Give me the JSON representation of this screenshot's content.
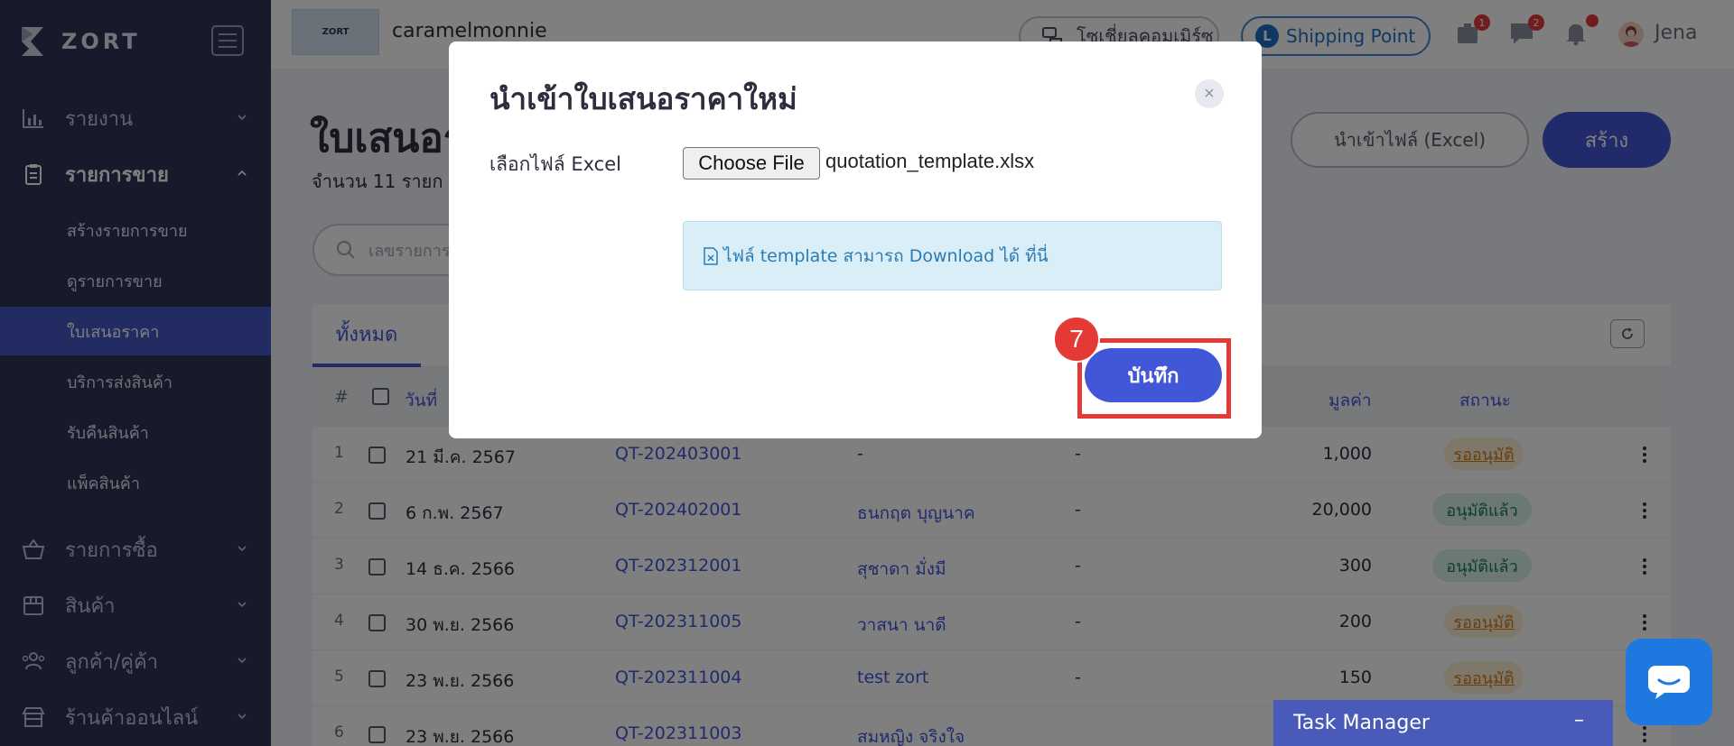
{
  "brand": {
    "name": "ZORT"
  },
  "sidebar": {
    "sections": [
      {
        "label": "รายงาน"
      },
      {
        "label": "รายการขาย"
      },
      {
        "label": "รายการซื้อ"
      },
      {
        "label": "สินค้า"
      },
      {
        "label": "ลูกค้า/คู่ค้า"
      },
      {
        "label": "ร้านค้าออนไลน์"
      }
    ],
    "sales_items": [
      {
        "label": "สร้างรายการขาย"
      },
      {
        "label": "ดูรายการขาย"
      },
      {
        "label": "ใบเสนอราคา"
      },
      {
        "label": "บริการส่งสินค้า"
      },
      {
        "label": "รับคืนสินค้า"
      },
      {
        "label": "แพ็คสินค้า"
      }
    ]
  },
  "header": {
    "shop_logo_text": "ZORT",
    "shop_name": "caramelmonnie",
    "social_label": "โซเชี่ยลคอมเมิร์ซ",
    "shipping_letter": "L",
    "shipping_label": "Shipping Point",
    "badges": {
      "box": "1",
      "chat": "2",
      "bell": ""
    },
    "user_name": "Jena"
  },
  "page": {
    "title": "ใบเสนอร",
    "subtitle": "จำนวน 11 รายก",
    "import_button": "นำเข้าไฟล์ (Excel)",
    "create_button": "สร้าง",
    "search_placeholder": "เลขรายการ"
  },
  "table": {
    "active_tab": "ทั้งหมด",
    "headers": {
      "num": "#",
      "date": "วันที่",
      "value": "มูลค่า",
      "status": "สถานะ"
    },
    "rows": [
      {
        "num": "1",
        "date": "21 มี.ค. 2567",
        "doc": "QT-202403001",
        "customer": "-",
        "ref": "-",
        "value": "1,000",
        "status": "รออนุมัติ",
        "status_type": "pending"
      },
      {
        "num": "2",
        "date": "6 ก.พ. 2567",
        "doc": "QT-202402001",
        "customer": "ธนกฤต บุญนาค",
        "ref": "-",
        "value": "20,000",
        "status": "อนุมัติแล้ว",
        "status_type": "approved"
      },
      {
        "num": "3",
        "date": "14 ธ.ค. 2566",
        "doc": "QT-202312001",
        "customer": "สุชาดา มั่งมี",
        "ref": "-",
        "value": "300",
        "status": "อนุมัติแล้ว",
        "status_type": "approved"
      },
      {
        "num": "4",
        "date": "30 พ.ย. 2566",
        "doc": "QT-202311005",
        "customer": "วาสนา นาดี",
        "ref": "-",
        "value": "200",
        "status": "รออนุมัติ",
        "status_type": "pending"
      },
      {
        "num": "5",
        "date": "23 พ.ย. 2566",
        "doc": "QT-202311004",
        "customer": "test zort",
        "ref": "-",
        "value": "150",
        "status": "รออนุมัติ",
        "status_type": "pending"
      },
      {
        "num": "6",
        "date": "23 พ.ย. 2566",
        "doc": "QT-202311003",
        "customer": "สมหญิง จริงใจ",
        "ref": "-",
        "value": "",
        "status": "",
        "status_type": ""
      }
    ]
  },
  "task_manager": {
    "label": "Task Manager",
    "minimize": "–"
  },
  "modal": {
    "title": "นำเข้าใบเสนอราคาใหม่",
    "close": "×",
    "file_label": "เลือกไฟล์ Excel",
    "choose_file": "Choose File",
    "file_name": "quotation_template.xlsx",
    "info_text": "ไฟล์ template สามารถ Download ได้ ที่นี่",
    "save_button": "บันทึก"
  },
  "annotation": {
    "step": "7"
  },
  "colors": {
    "primary": "#4257d8",
    "sidebar": "#2d3554",
    "highlight": "#e53935"
  }
}
